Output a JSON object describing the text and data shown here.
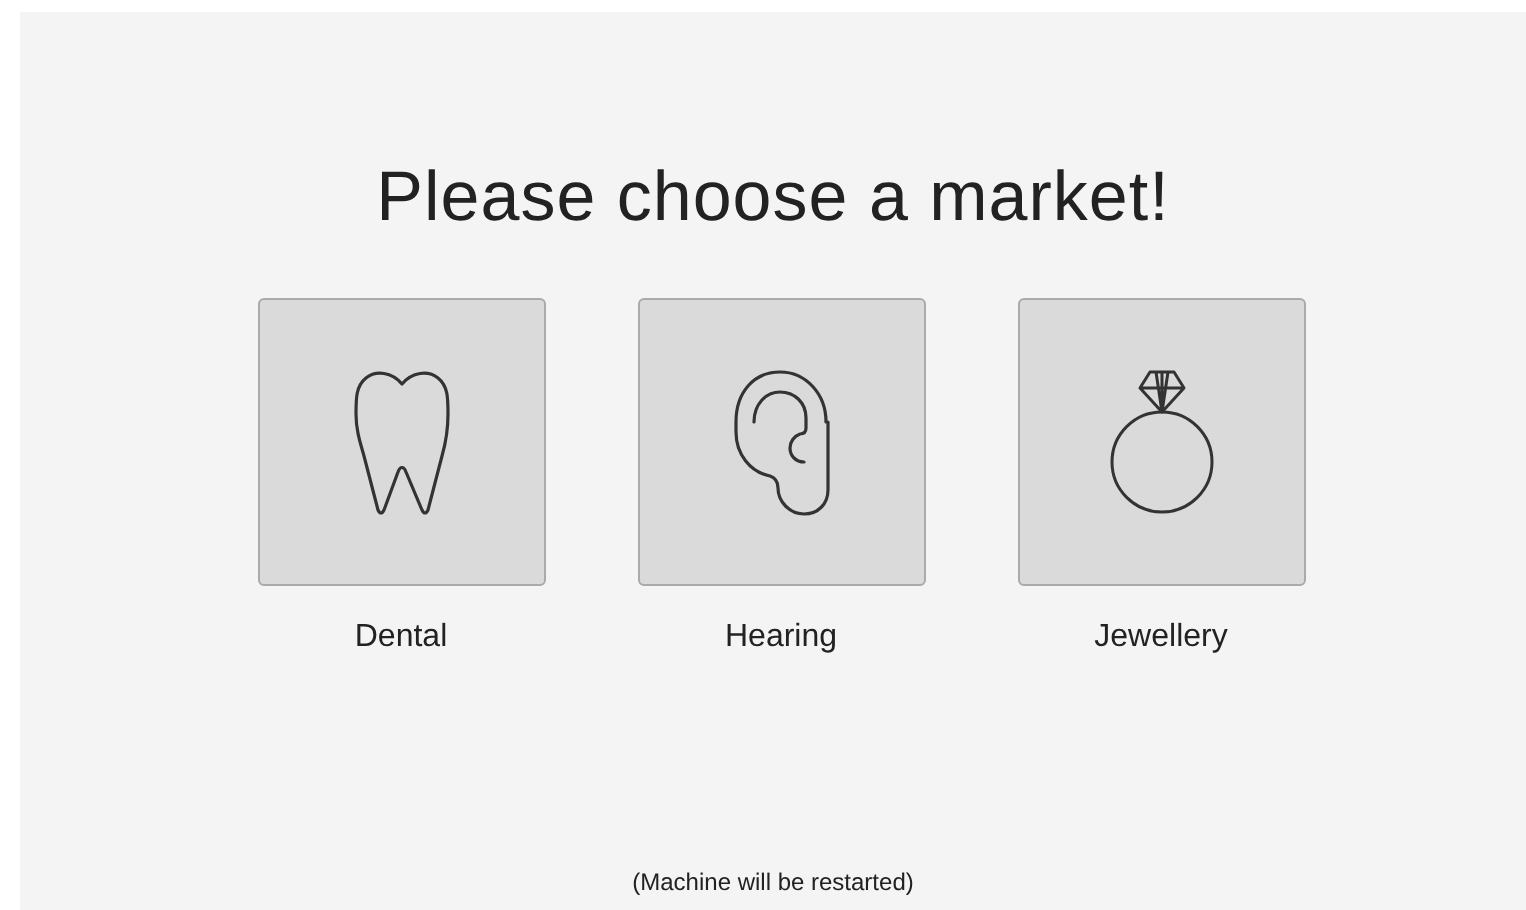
{
  "title": "Please choose a market!",
  "markets": [
    {
      "kind": "tooth",
      "label": "Dental"
    },
    {
      "kind": "ear",
      "label": "Hearing"
    },
    {
      "kind": "ring",
      "label": "Jewellery"
    }
  ],
  "footer": "(Machine will be restarted)"
}
